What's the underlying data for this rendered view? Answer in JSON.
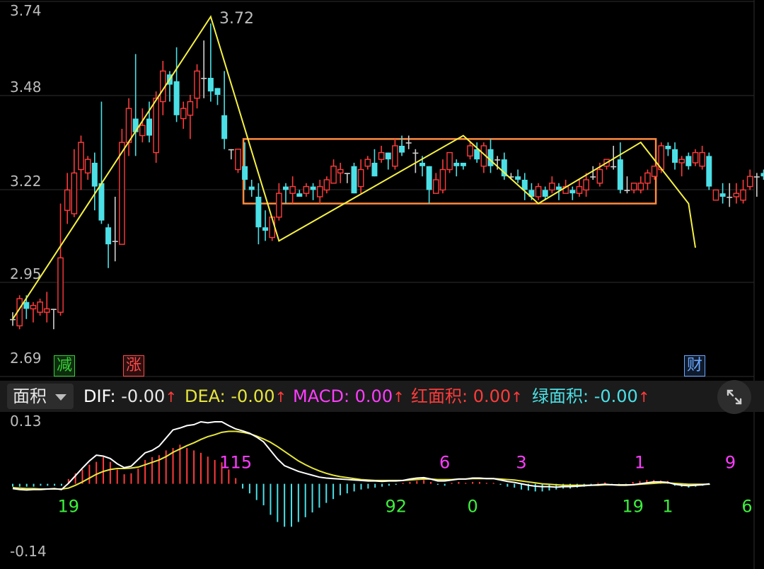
{
  "colors": {
    "up": "#ff3b3b",
    "down": "#4be0e6",
    "flat": "#cfcfcf",
    "zigzag": "#f5f142",
    "box": "#ff8a3d",
    "dif": "#ffffff",
    "dea": "#e6e63c",
    "grid": "#2e2e2e",
    "axis_text": "#bdbdbd",
    "magenta": "#ff3dff",
    "green": "#3cf03c"
  },
  "tabs": {
    "area_label": "面积"
  },
  "indicators": [
    {
      "name": "DIF: ",
      "value": "-0.00",
      "color": "#ffffff"
    },
    {
      "name": "DEA: ",
      "value": "-0.00",
      "color": "#e6e63c"
    },
    {
      "name": "MACD: ",
      "value": "0.00",
      "color": "#ff3dff"
    },
    {
      "name": "红面积: ",
      "value": "0.00",
      "color": "#ff3b3b"
    },
    {
      "name": "绿面积: ",
      "value": "-0.00",
      "color": "#4be0e6"
    }
  ],
  "arrow_glyph": "↑",
  "badges": {
    "jian": "减",
    "zhang": "涨",
    "cai": "财"
  },
  "icons": {
    "expand": "expand-arrows-icon",
    "caret": "caret-down-icon"
  },
  "chart_data": [
    {
      "type": "candlestick",
      "y_ticks": [
        "3.74",
        "3.48",
        "3.22",
        "2.95",
        "2.69"
      ],
      "ylim": [
        2.69,
        3.74
      ],
      "peak_label": "3.72",
      "candles": [
        [
          2.83,
          2.83,
          2.81,
          2.85
        ],
        [
          2.81,
          2.89,
          2.8,
          2.9
        ],
        [
          2.88,
          2.86,
          2.83,
          2.9
        ],
        [
          2.86,
          2.87,
          2.82,
          2.88
        ],
        [
          2.85,
          2.88,
          2.84,
          2.89
        ],
        [
          2.85,
          2.86,
          2.82,
          2.91
        ],
        [
          2.86,
          2.86,
          2.8,
          2.86
        ],
        [
          2.85,
          3.01,
          2.84,
          3.17
        ],
        [
          3.15,
          3.21,
          3.11,
          3.26
        ],
        [
          3.14,
          3.26,
          3.13,
          3.33
        ],
        [
          3.27,
          3.35,
          3.21,
          3.37
        ],
        [
          3.26,
          3.3,
          3.24,
          3.31
        ],
        [
          3.29,
          3.22,
          3.15,
          3.32
        ],
        [
          3.23,
          3.12,
          3.11,
          3.47
        ],
        [
          3.1,
          3.05,
          2.98,
          3.11
        ],
        [
          3.06,
          3.06,
          3.0,
          3.19
        ],
        [
          3.05,
          3.35,
          3.05,
          3.39
        ],
        [
          3.35,
          3.45,
          3.31,
          3.48
        ],
        [
          3.42,
          3.38,
          3.31,
          3.61
        ],
        [
          3.37,
          3.4,
          3.35,
          3.45
        ],
        [
          3.42,
          3.37,
          3.35,
          3.47
        ],
        [
          3.32,
          3.48,
          3.29,
          3.5
        ],
        [
          3.47,
          3.56,
          3.43,
          3.59
        ],
        [
          3.55,
          3.52,
          3.47,
          3.56
        ],
        [
          3.53,
          3.43,
          3.41,
          3.63
        ],
        [
          3.42,
          3.45,
          3.39,
          3.47
        ],
        [
          3.43,
          3.47,
          3.36,
          3.49
        ],
        [
          3.48,
          3.56,
          3.45,
          3.58
        ],
        [
          3.54,
          3.54,
          3.48,
          3.65
        ],
        [
          3.54,
          3.5,
          3.47,
          3.7
        ],
        [
          3.51,
          3.49,
          3.46,
          3.51
        ],
        [
          3.43,
          3.36,
          3.33,
          3.56
        ],
        [
          3.33,
          3.33,
          3.3,
          3.33
        ],
        [
          3.27,
          3.33,
          3.26,
          3.33
        ],
        [
          3.28,
          3.24,
          3.21,
          3.35
        ],
        [
          3.22,
          3.21,
          3.19,
          3.24
        ],
        [
          3.19,
          3.1,
          3.05,
          3.23
        ],
        [
          3.1,
          3.09,
          3.06,
          3.15
        ],
        [
          3.07,
          3.13,
          3.06,
          3.13
        ],
        [
          3.13,
          3.2,
          3.12,
          3.23
        ],
        [
          3.22,
          3.21,
          3.17,
          3.23
        ],
        [
          3.2,
          3.22,
          3.17,
          3.25
        ],
        [
          3.2,
          3.19,
          3.19,
          3.21
        ],
        [
          3.2,
          3.22,
          3.19,
          3.23
        ],
        [
          3.22,
          3.21,
          3.18,
          3.23
        ],
        [
          3.19,
          3.22,
          3.17,
          3.24
        ],
        [
          3.21,
          3.24,
          3.2,
          3.25
        ],
        [
          3.23,
          3.28,
          3.23,
          3.3
        ],
        [
          3.26,
          3.27,
          3.23,
          3.29
        ],
        [
          3.26,
          3.26,
          3.23,
          3.26
        ],
        [
          3.28,
          3.2,
          3.2,
          3.29
        ],
        [
          3.22,
          3.27,
          3.2,
          3.3
        ],
        [
          3.28,
          3.3,
          3.27,
          3.31
        ],
        [
          3.29,
          3.25,
          3.25,
          3.33
        ],
        [
          3.3,
          3.32,
          3.29,
          3.34
        ],
        [
          3.32,
          3.3,
          3.27,
          3.32
        ],
        [
          3.28,
          3.34,
          3.27,
          3.36
        ],
        [
          3.34,
          3.32,
          3.31,
          3.37
        ],
        [
          3.35,
          3.35,
          3.33,
          3.37
        ],
        [
          3.32,
          3.32,
          3.26,
          3.33
        ],
        [
          3.29,
          3.28,
          3.25,
          3.31
        ],
        [
          3.28,
          3.21,
          3.17,
          3.28
        ],
        [
          3.2,
          3.24,
          3.2,
          3.26
        ],
        [
          3.21,
          3.27,
          3.2,
          3.3
        ],
        [
          3.27,
          3.32,
          3.26,
          3.32
        ],
        [
          3.29,
          3.28,
          3.25,
          3.3
        ],
        [
          3.29,
          3.28,
          3.27,
          3.29
        ],
        [
          3.31,
          3.34,
          3.3,
          3.35
        ],
        [
          3.33,
          3.3,
          3.29,
          3.35
        ],
        [
          3.28,
          3.34,
          3.26,
          3.35
        ],
        [
          3.33,
          3.28,
          3.26,
          3.36
        ],
        [
          3.3,
          3.3,
          3.27,
          3.31
        ],
        [
          3.3,
          3.25,
          3.24,
          3.32
        ],
        [
          3.25,
          3.25,
          3.24,
          3.26
        ],
        [
          3.25,
          3.24,
          3.23,
          3.27
        ],
        [
          3.24,
          3.21,
          3.18,
          3.26
        ],
        [
          3.21,
          3.19,
          3.18,
          3.23
        ],
        [
          3.19,
          3.22,
          3.18,
          3.23
        ],
        [
          3.21,
          3.19,
          3.18,
          3.22
        ],
        [
          3.21,
          3.23,
          3.2,
          3.25
        ],
        [
          3.22,
          3.21,
          3.18,
          3.23
        ],
        [
          3.2,
          3.22,
          3.2,
          3.24
        ],
        [
          3.21,
          3.2,
          3.18,
          3.22
        ],
        [
          3.2,
          3.22,
          3.19,
          3.24
        ],
        [
          3.21,
          3.24,
          3.19,
          3.26
        ],
        [
          3.25,
          3.25,
          3.24,
          3.28
        ],
        [
          3.23,
          3.27,
          3.22,
          3.29
        ],
        [
          3.28,
          3.3,
          3.27,
          3.3
        ],
        [
          3.28,
          3.28,
          3.27,
          3.34
        ],
        [
          3.3,
          3.21,
          3.2,
          3.35
        ],
        [
          3.21,
          3.21,
          3.2,
          3.25
        ],
        [
          3.21,
          3.23,
          3.2,
          3.23
        ],
        [
          3.21,
          3.23,
          3.2,
          3.25
        ],
        [
          3.23,
          3.26,
          3.21,
          3.27
        ],
        [
          3.25,
          3.28,
          3.24,
          3.28
        ],
        [
          3.27,
          3.34,
          3.26,
          3.35
        ],
        [
          3.34,
          3.33,
          3.31,
          3.35
        ],
        [
          3.33,
          3.29,
          3.27,
          3.35
        ],
        [
          3.29,
          3.3,
          3.25,
          3.31
        ],
        [
          3.31,
          3.28,
          3.27,
          3.32
        ],
        [
          3.29,
          3.32,
          3.28,
          3.33
        ],
        [
          3.28,
          3.32,
          3.27,
          3.34
        ],
        [
          3.31,
          3.22,
          3.21,
          3.32
        ],
        [
          3.18,
          3.21,
          3.18,
          3.21
        ],
        [
          3.2,
          3.19,
          3.17,
          3.23
        ],
        [
          3.19,
          3.19,
          3.16,
          3.23
        ],
        [
          3.19,
          3.2,
          3.17,
          3.23
        ],
        [
          3.18,
          3.21,
          3.17,
          3.24
        ],
        [
          3.22,
          3.25,
          3.21,
          3.27
        ],
        [
          3.25,
          3.25,
          3.19,
          3.26
        ],
        [
          3.26,
          3.25,
          3.24,
          3.27
        ],
        [
          3.19,
          3.32,
          3.18,
          3.37
        ]
      ],
      "zigzag": [
        [
          0,
          2.83
        ],
        [
          29,
          3.72
        ],
        [
          39,
          3.06
        ],
        [
          66,
          3.37
        ],
        [
          77,
          3.17
        ],
        [
          92,
          3.35
        ],
        [
          99,
          3.17
        ],
        [
          100,
          3.04
        ],
        [
          100,
          3.04
        ]
      ],
      "range_box": {
        "from": 34,
        "to": 94,
        "low": 3.17,
        "high": 3.36
      }
    },
    {
      "type": "macd",
      "y_ticks": [
        "0.13",
        "-0.14"
      ],
      "ylim": [
        -0.14,
        0.13
      ],
      "dif": [
        -0.01,
        -0.012,
        -0.013,
        -0.012,
        -0.012,
        -0.011,
        -0.01,
        -0.012,
        0.001,
        0.017,
        0.033,
        0.048,
        0.06,
        0.058,
        0.053,
        0.042,
        0.034,
        0.037,
        0.051,
        0.065,
        0.07,
        0.079,
        0.096,
        0.113,
        0.117,
        0.122,
        0.124,
        0.13,
        0.128,
        0.13,
        0.13,
        0.122,
        0.115,
        0.111,
        0.106,
        0.098,
        0.088,
        0.07,
        0.052,
        0.038,
        0.032,
        0.026,
        0.022,
        0.018,
        0.014,
        0.012,
        0.011,
        0.01,
        0.009,
        0.008,
        0.007,
        0.006,
        0.006,
        0.005,
        0.006,
        0.006,
        0.007,
        0.01,
        0.012,
        0.013,
        0.01,
        0.006,
        0.006,
        0.008,
        0.01,
        0.01,
        0.012,
        0.012,
        0.011,
        0.011,
        0.008,
        0.005,
        0.003,
        0.0,
        -0.003,
        -0.005,
        -0.006,
        -0.006,
        -0.007,
        -0.006,
        -0.006,
        -0.005,
        -0.004,
        -0.003,
        -0.002,
        -0.001,
        -0.002,
        -0.003,
        -0.003,
        -0.002,
        0.0,
        0.002,
        0.004,
        0.004,
        0.003,
        -0.001,
        -0.003,
        -0.004,
        -0.003,
        -0.002,
        0.0
      ],
      "dea": [
        -0.008,
        -0.009,
        -0.01,
        -0.01,
        -0.011,
        -0.011,
        -0.011,
        -0.011,
        -0.009,
        -0.003,
        0.004,
        0.012,
        0.02,
        0.026,
        0.03,
        0.032,
        0.032,
        0.033,
        0.035,
        0.04,
        0.045,
        0.05,
        0.057,
        0.066,
        0.073,
        0.08,
        0.086,
        0.093,
        0.099,
        0.103,
        0.108,
        0.11,
        0.11,
        0.108,
        0.105,
        0.1,
        0.094,
        0.087,
        0.078,
        0.068,
        0.058,
        0.048,
        0.04,
        0.033,
        0.027,
        0.022,
        0.018,
        0.015,
        0.013,
        0.011,
        0.009,
        0.008,
        0.007,
        0.007,
        0.007,
        0.007,
        0.007,
        0.008,
        0.009,
        0.01,
        0.01,
        0.009,
        0.009,
        0.009,
        0.01,
        0.01,
        0.011,
        0.011,
        0.011,
        0.011,
        0.01,
        0.009,
        0.008,
        0.006,
        0.004,
        0.002,
        0.0,
        -0.001,
        -0.002,
        -0.003,
        -0.003,
        -0.003,
        -0.003,
        -0.003,
        -0.003,
        -0.002,
        -0.002,
        -0.002,
        -0.002,
        -0.002,
        -0.001,
        0.0,
        0.001,
        0.002,
        0.002,
        0.001,
        0.0,
        -0.001,
        -0.001,
        -0.001,
        -0.001
      ],
      "histogram": [
        -0.006,
        -0.006,
        -0.006,
        -0.006,
        -0.004,
        -0.004,
        -0.004,
        -0.004,
        0.01,
        0.022,
        0.03,
        0.04,
        0.046,
        0.056,
        0.046,
        0.03,
        0.02,
        0.022,
        0.032,
        0.05,
        0.056,
        0.06,
        0.07,
        0.075,
        0.082,
        0.075,
        0.07,
        0.065,
        0.057,
        0.05,
        0.045,
        0.03,
        0.012,
        -0.01,
        -0.02,
        -0.034,
        -0.045,
        -0.065,
        -0.08,
        -0.09,
        -0.09,
        -0.08,
        -0.07,
        -0.06,
        -0.05,
        -0.04,
        -0.032,
        -0.024,
        -0.02,
        -0.016,
        -0.012,
        -0.01,
        -0.008,
        -0.006,
        -0.004,
        -0.002,
        0.002,
        0.004,
        0.006,
        0.008,
        0.004,
        -0.002,
        -0.004,
        0.002,
        0.004,
        0.002,
        0.004,
        0.004,
        0.002,
        0.002,
        -0.002,
        -0.006,
        -0.008,
        -0.012,
        -0.014,
        -0.016,
        -0.016,
        -0.014,
        -0.012,
        -0.01,
        -0.01,
        -0.008,
        -0.006,
        -0.002,
        0.002,
        0.003,
        -0.002,
        -0.003,
        -0.002,
        0.004,
        0.006,
        0.008,
        0.008,
        0.007,
        0.006,
        -0.004,
        -0.006,
        -0.008,
        -0.006,
        -0.004,
        -0.002
      ],
      "counts": [
        {
          "text": "19",
          "color": "green",
          "pos": "below",
          "i": 8
        },
        {
          "text": "115",
          "color": "magenta",
          "pos": "above",
          "i": 32
        },
        {
          "text": "92",
          "color": "green",
          "pos": "below",
          "i": 55
        },
        {
          "text": "6",
          "color": "magenta",
          "pos": "above",
          "i": 62
        },
        {
          "text": "0",
          "color": "green",
          "pos": "below",
          "i": 66
        },
        {
          "text": "3",
          "color": "magenta",
          "pos": "above",
          "i": 73
        },
        {
          "text": "1",
          "color": "magenta",
          "pos": "above",
          "i": 90
        },
        {
          "text": "19",
          "color": "green",
          "pos": "below",
          "i": 89
        },
        {
          "text": "1",
          "color": "green",
          "pos": "below",
          "i": 94
        },
        {
          "text": "9",
          "color": "magenta",
          "pos": "above",
          "i": 103
        },
        {
          "text": "6",
          "color": "green",
          "pos": "below",
          "i": 109
        }
      ]
    }
  ]
}
